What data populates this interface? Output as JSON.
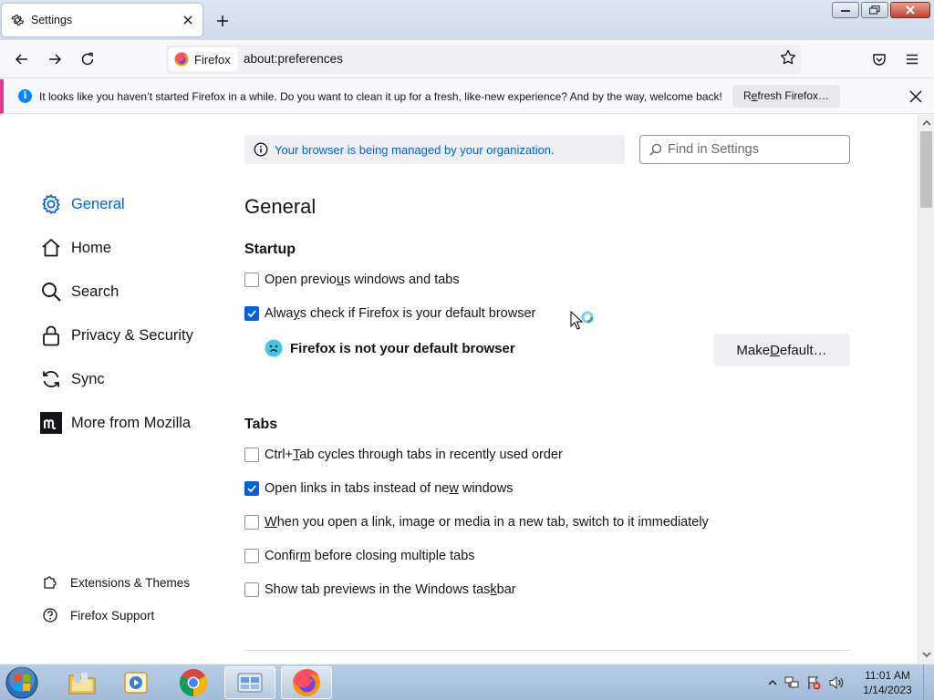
{
  "window": {
    "tab_title": "Settings",
    "tab_icon": "gear-icon"
  },
  "navbar": {
    "identity_label": "Firefox",
    "url": "about:preferences"
  },
  "notification": {
    "message": "It looks like you haven’t started Firefox in a while. Do you want to clean it up for a fresh, like-new experience? And by the way, welcome back!",
    "button": {
      "pre": "R",
      "key": "e",
      "post": "fresh Firefox…"
    },
    "accent_color": "#e13b91"
  },
  "managed_notice": "Your browser is being managed by your organization.",
  "search": {
    "placeholder": "Find in Settings"
  },
  "sidebar": {
    "items": [
      {
        "label": "General",
        "icon": "gear-icon",
        "active": true
      },
      {
        "label": "Home",
        "icon": "home-icon",
        "active": false
      },
      {
        "label": "Search",
        "icon": "search-icon",
        "active": false
      },
      {
        "label": "Privacy & Security",
        "icon": "lock-icon",
        "active": false
      },
      {
        "label": "Sync",
        "icon": "sync-icon",
        "active": false
      },
      {
        "label": "More from Mozilla",
        "icon": "mozilla-icon",
        "active": false
      }
    ],
    "footer": [
      {
        "label": "Extensions & Themes",
        "icon": "puzzle-icon"
      },
      {
        "label": "Firefox Support",
        "icon": "help-icon"
      }
    ]
  },
  "main": {
    "heading": "General",
    "startup": {
      "title": "Startup",
      "options": [
        {
          "pre": "Open previo",
          "key": "u",
          "post": "s windows and tabs",
          "checked": false
        },
        {
          "pre": "Alwa",
          "key": "y",
          "post": "s check if Firefox is your default browser",
          "checked": true
        }
      ],
      "default_status": "Firefox is not your default browser",
      "make_default": {
        "pre": "Make ",
        "key": "D",
        "post": "efault…"
      }
    },
    "tabs": {
      "title": "Tabs",
      "options": [
        {
          "pre": "Ctrl+",
          "key": "T",
          "post": "ab cycles through tabs in recently used order",
          "checked": false
        },
        {
          "pre": "Open links in tabs instead of ne",
          "key": "w",
          "post": " windows",
          "checked": true
        },
        {
          "pre": "",
          "key": "W",
          "post": "hen you open a link, image or media in a new tab, switch to it immediately",
          "checked": false
        },
        {
          "pre": "Confir",
          "key": "m",
          "post": " before closing multiple tabs",
          "checked": false
        },
        {
          "pre": "Show tab previews in the Windows tas",
          "key": "k",
          "post": "bar",
          "checked": false
        }
      ]
    }
  },
  "taskbar": {
    "apps": [
      {
        "name": "file-explorer",
        "icon": "folder-icon",
        "active": false
      },
      {
        "name": "media-player",
        "icon": "media-player-icon",
        "active": false
      },
      {
        "name": "chrome",
        "icon": "chrome-icon",
        "active": false
      },
      {
        "name": "control-panel",
        "icon": "control-panel-icon",
        "active": true
      },
      {
        "name": "firefox",
        "icon": "firefox-icon",
        "active": true
      }
    ],
    "clock": {
      "time": "11:01 AM",
      "date": "1/14/2023"
    }
  },
  "colors": {
    "accent": "#0061e0",
    "text": "#15141a",
    "checkbox_checked": "#0061e0"
  }
}
